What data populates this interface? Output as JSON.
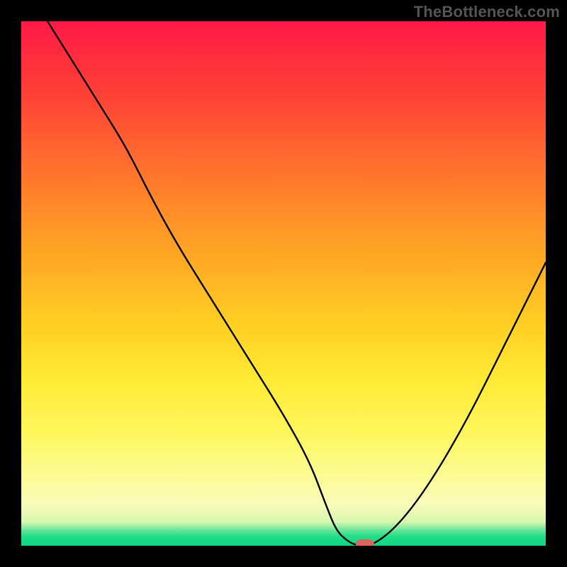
{
  "watermark": "TheBottleneck.com",
  "chart_data": {
    "type": "line",
    "title": "",
    "xlabel": "",
    "ylabel": "",
    "xlim": [
      0,
      100
    ],
    "ylim": [
      0,
      100
    ],
    "grid": false,
    "legend": false,
    "background": "rainbow-vertical-gradient",
    "series": [
      {
        "name": "bottleneck-curve",
        "x": [
          5,
          10,
          15,
          20,
          25,
          30,
          35,
          40,
          45,
          50,
          55,
          58,
          60,
          62,
          64,
          67,
          72,
          78,
          85,
          92,
          100
        ],
        "y": [
          100,
          92,
          84,
          76,
          66,
          57,
          49,
          41,
          33,
          25,
          16,
          8,
          3,
          1,
          0,
          0,
          4,
          12,
          24,
          38,
          54
        ]
      }
    ],
    "annotations": [
      {
        "name": "minimum-marker",
        "type": "pill",
        "x": 65.5,
        "y": 0,
        "color": "#d9675e"
      }
    ],
    "colors": {
      "gradient_top": "#ff1a4a",
      "gradient_mid": "#ffe933",
      "gradient_bottom": "#0fd683",
      "curve": "#000000",
      "frame": "#000000"
    }
  }
}
